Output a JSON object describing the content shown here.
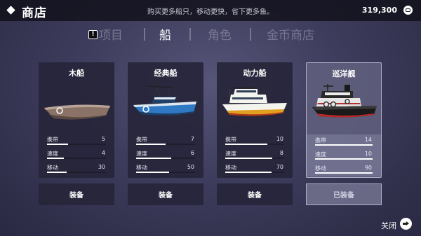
{
  "header": {
    "title": "商店",
    "subtitle": "购买更多船只，移动更快，省下更多鱼。",
    "coins": "319,300",
    "coin_icon": "coin-icon"
  },
  "tabs": [
    {
      "label": "项目",
      "active": false,
      "badge": "!"
    },
    {
      "label": "船",
      "active": true
    },
    {
      "label": "角色",
      "active": false
    },
    {
      "label": "金币商店",
      "active": false
    }
  ],
  "boats": [
    {
      "name": "木船",
      "stats": [
        {
          "label": "携带",
          "value": "5",
          "level": 0.36
        },
        {
          "label": "速度",
          "value": "4",
          "level": 0.29
        },
        {
          "label": "移动",
          "value": "30",
          "level": 0.33
        }
      ],
      "button": "装备",
      "equipped": false
    },
    {
      "name": "经典船",
      "stats": [
        {
          "label": "携带",
          "value": "7",
          "level": 0.5
        },
        {
          "label": "速度",
          "value": "6",
          "level": 0.6
        },
        {
          "label": "移动",
          "value": "50",
          "level": 0.56
        }
      ],
      "button": "装备",
      "equipped": false
    },
    {
      "name": "动力船",
      "stats": [
        {
          "label": "携带",
          "value": "10",
          "level": 0.71
        },
        {
          "label": "速度",
          "value": "8",
          "level": 0.8
        },
        {
          "label": "移动",
          "value": "70",
          "level": 0.78
        }
      ],
      "button": "装备",
      "equipped": false
    },
    {
      "name": "巡洋舰",
      "stats": [
        {
          "label": "携带",
          "value": "14",
          "level": 1.0
        },
        {
          "label": "速度",
          "value": "10",
          "level": 1.0
        },
        {
          "label": "移动",
          "value": "90",
          "level": 1.0
        }
      ],
      "button": "已装备",
      "equipped": true
    }
  ],
  "footer": {
    "close_label": "关闭",
    "close_icon": "arrow-right-icon"
  }
}
